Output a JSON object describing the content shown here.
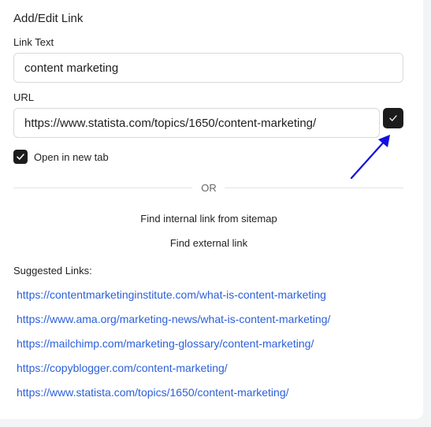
{
  "dialog": {
    "title": "Add/Edit Link",
    "link_text_label": "Link Text",
    "link_text_value": "content marketing",
    "url_label": "URL",
    "url_value": "https://www.statista.com/topics/1650/content-marketing/",
    "confirm_icon": "check-icon",
    "open_new_tab_label": "Open in new tab",
    "open_new_tab_checked": true,
    "divider_text": "OR",
    "find_internal_label": "Find internal link from sitemap",
    "find_external_label": "Find external link",
    "suggested_label": "Suggested Links:",
    "suggested_links": [
      "https://contentmarketinginstitute.com/what-is-content-marketing",
      "https://www.ama.org/marketing-news/what-is-content-marketing/",
      "https://mailchimp.com/marketing-glossary/content-marketing/",
      "https://copyblogger.com/content-marketing/",
      "https://www.statista.com/topics/1650/content-marketing/"
    ]
  },
  "colors": {
    "accent_dark": "#1c1c1c",
    "link_blue": "#2b5fd9",
    "annotation_arrow": "#1010e0"
  }
}
